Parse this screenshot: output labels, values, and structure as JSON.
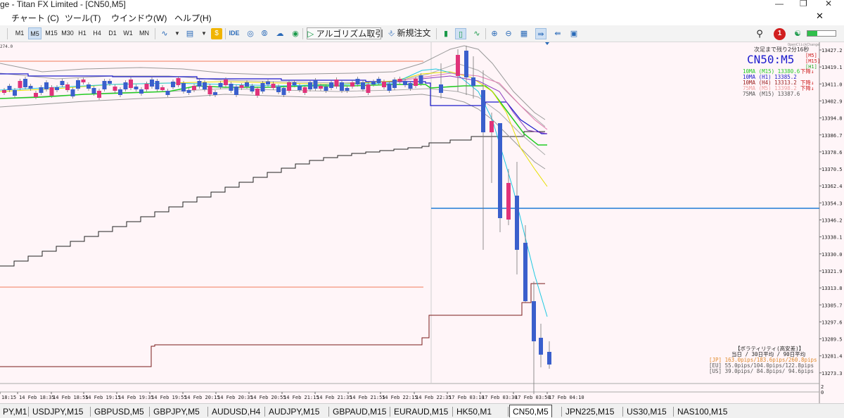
{
  "window": {
    "title": "ge - Titan FX Limited - [CN50,M5]"
  },
  "menu": [
    "チャート (C)",
    "ツール(T)",
    "ウインドウ(W)",
    "ヘルプ(H)"
  ],
  "toolbar": {
    "timeframes": [
      "M1",
      "M5",
      "M15",
      "M30",
      "H1",
      "H4",
      "D1",
      "W1",
      "MN"
    ],
    "selected_timeframe": "M5",
    "ide_label": "IDE",
    "algo_label": "アルゴリズム取引",
    "new_order_label": "新規注文",
    "notification_count": "1"
  },
  "chart": {
    "symbol": "CN50:M5",
    "top_left_value": "274.0",
    "countdown": "次足まで残り2分16秒",
    "chart_label": "OpenClickChange",
    "ma_tags": [
      "[M5]",
      "[M15]",
      "[H1]"
    ],
    "ma_lines": [
      {
        "text": "10MA (M15)  13380.6",
        "trend": "下降↓",
        "color": "#22cc22"
      },
      {
        "text": "10MA (H1)   13385.2",
        "trend": "",
        "color": "#1a1acc"
      },
      {
        "text": "10MA (H4)   13313.2",
        "trend": "下降↓",
        "color": "#991a1a"
      },
      {
        "text": "75MA (M5)   13398.2",
        "trend": "下降↓",
        "color": "#f0a0a0"
      },
      {
        "text": "75MA (M15)  13387.6",
        "trend": "",
        "color": "#555555"
      }
    ],
    "price_ticks": [
      "13427.2",
      "13419.1",
      "13411.0",
      "13402.9",
      "13394.8",
      "13386.7",
      "13378.6",
      "13370.5",
      "13362.4",
      "13354.3",
      "13346.2",
      "13338.1",
      "13330.0",
      "13321.9",
      "13313.8",
      "13305.7",
      "13297.6",
      "13289.5",
      "13281.4",
      "13273.3"
    ],
    "time_ticks": [
      "18:15",
      "14 Feb 18:35",
      "14 Feb 18:55",
      "14 Feb 19:15",
      "14 Feb 19:35",
      "14 Feb 19:55",
      "14 Feb 20:15",
      "14 Feb 20:35",
      "14 Feb 20:55",
      "14 Feb 21:15",
      "14 Feb 21:35",
      "14 Feb 21:55",
      "14 Feb 22:15",
      "14 Feb 22:35",
      "17 Feb 03:10",
      "17 Feb 03:30",
      "17 Feb 03:50",
      "17 Feb 04:10"
    ],
    "volatility": {
      "title": "【ボラティリティ(高安差)】",
      "header": "当日 / 30日平均 / 90日平均",
      "rows": [
        {
          "text": "[JP] 163.0pips/183.6pips/260.8pips",
          "color": "#e08a2a"
        },
        {
          "text": "[EU]  55.0pips/104.0pips/122.8pips",
          "color": "#555555"
        },
        {
          "text": "[US]  39.0pips/ 84.8pips/ 94.6pips",
          "color": "#555555"
        }
      ]
    },
    "subwindow_ticks": [
      "2",
      "0"
    ]
  },
  "tabs": [
    "PY,M1",
    "USDJPY,M15",
    "GBPUSD,M5",
    "GBPJPY,M5",
    "AUDUSD,H4",
    "AUDJPY,M15",
    "GBPAUD,M15",
    "EURAUD,M15",
    "HK50,M1",
    "CN50,M5",
    "JPN225,M15",
    "US30,M15",
    "NAS100,M15"
  ],
  "active_tab": "CN50,M5"
}
